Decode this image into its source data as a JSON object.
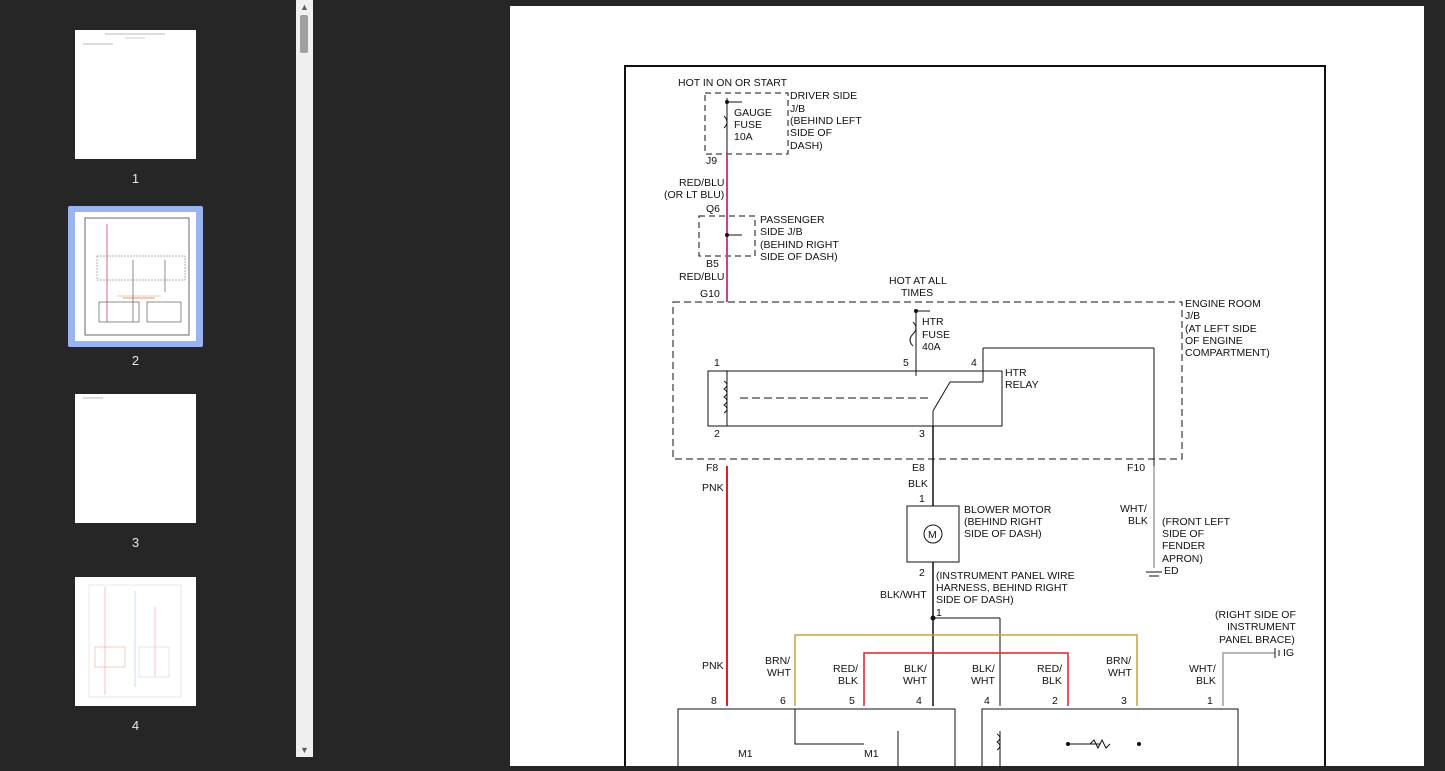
{
  "thumbnails": [
    {
      "page": "1"
    },
    {
      "page": "2"
    },
    {
      "page": "3"
    },
    {
      "page": "4"
    }
  ],
  "diagram": {
    "hot_in_on": "HOT IN ON OR START",
    "driver_jb": [
      "DRIVER SIDE",
      "J/B",
      "(BEHIND LEFT",
      "SIDE OF",
      "DASH)"
    ],
    "gauge_fuse": [
      "GAUGE",
      "FUSE",
      "10A"
    ],
    "j9": "J9",
    "red_blu_1": "RED/BLU",
    "or_lt_blu": "(OR LT BLU)",
    "q6": "Q6",
    "pass_jb": [
      "PASSENGER",
      "SIDE J/B",
      "(BEHIND RIGHT",
      "SIDE OF DASH)"
    ],
    "b5": "B5",
    "red_blu_2": "RED/BLU",
    "g10": "G10",
    "hot_at_all": [
      "HOT AT ALL",
      "TIMES"
    ],
    "engine_jb": [
      "ENGINE ROOM",
      "J/B",
      "(AT LEFT SIDE",
      "OF ENGINE",
      "COMPARTMENT)"
    ],
    "htr_fuse": [
      "HTR",
      "FUSE",
      "40A"
    ],
    "htr_relay": [
      "HTR",
      "RELAY"
    ],
    "pin1": "1",
    "pin5": "5",
    "pin4": "4",
    "pin2": "2",
    "pin3": "3",
    "f8": "F8",
    "e8": "E8",
    "f10": "F10",
    "pnk_1": "PNK",
    "blk": "BLK",
    "motor_pin1": "1",
    "blower": [
      "BLOWER MOTOR",
      "(BEHIND RIGHT",
      "SIDE OF DASH)"
    ],
    "motor_letter": "M",
    "motor_pin2": "2",
    "ip_harness": [
      "(INSTRUMENT PANEL WIRE",
      "HARNESS, BEHIND RIGHT",
      "SIDE OF DASH)"
    ],
    "blk_wht": "BLK/WHT",
    "splice_1": "1",
    "wht_blk_1": [
      "WHT/",
      "BLK"
    ],
    "fender": [
      "(FRONT LEFT",
      "SIDE OF",
      "FENDER",
      "APRON)"
    ],
    "ed": "ED",
    "right_ip": [
      "(RIGHT SIDE OF",
      "INSTRUMENT",
      "PANEL BRACE)"
    ],
    "ig": "IG",
    "pnk_2": "PNK",
    "brn_wht_1": [
      "BRN/",
      "WHT"
    ],
    "red_blk_1": [
      "RED/",
      "BLK"
    ],
    "blk_wht_1": [
      "BLK/",
      "WHT"
    ],
    "blk_wht_2": [
      "BLK/",
      "WHT"
    ],
    "red_blk_2": [
      "RED/",
      "BLK"
    ],
    "brn_wht_2": [
      "BRN/",
      "WHT"
    ],
    "wht_blk_2": [
      "WHT/",
      "BLK"
    ],
    "bottom_pins": [
      "8",
      "6",
      "5",
      "4",
      "4",
      "2",
      "3",
      "1"
    ],
    "m1_a": "M1",
    "m1_b": "M1"
  },
  "colors": {
    "background": "#262626",
    "selection": "#99b4f0",
    "wire_pink": "#d0408a",
    "wire_red": "#e02020",
    "wire_brown": "#c8a040",
    "wire_gray": "#a0a0a0"
  }
}
